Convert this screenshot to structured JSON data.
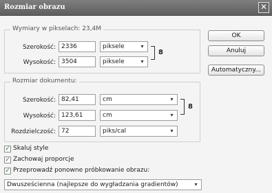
{
  "window": {
    "title": "Rozmiar obrazu",
    "close_glyph": "✕"
  },
  "pixel_dimensions": {
    "legend": "Wymiary w pikselach:",
    "size": "23,4M",
    "width_label": "Szerokość:",
    "width_value": "2336",
    "width_unit": "piksele",
    "height_label": "Wysokość:",
    "height_value": "3504",
    "height_unit": "piksele"
  },
  "document_size": {
    "legend": "Rozmiar dokumentu:",
    "width_label": "Szerokość:",
    "width_value": "82,41",
    "width_unit": "cm",
    "height_label": "Wysokość:",
    "height_value": "123,61",
    "height_unit": "cm",
    "resolution_label": "Rozdzielczość:",
    "resolution_value": "72",
    "resolution_unit": "piks/cal"
  },
  "buttons": {
    "ok": "OK",
    "cancel": "Anuluj",
    "auto": "Automatyczny..."
  },
  "options": {
    "scale_styles": {
      "label": "Skaluj style",
      "checked": true
    },
    "constrain": {
      "label": "Zachowaj proporcje",
      "checked": true
    },
    "resample": {
      "label": "Przeprowadź ponowne próbkowanie obrazu:",
      "checked": true
    },
    "resample_method": "Dwusześcienna (najlepsze do wygładzania gradientów)"
  },
  "glyphs": {
    "check": "✓",
    "dropdown": "▾",
    "link": "8"
  }
}
